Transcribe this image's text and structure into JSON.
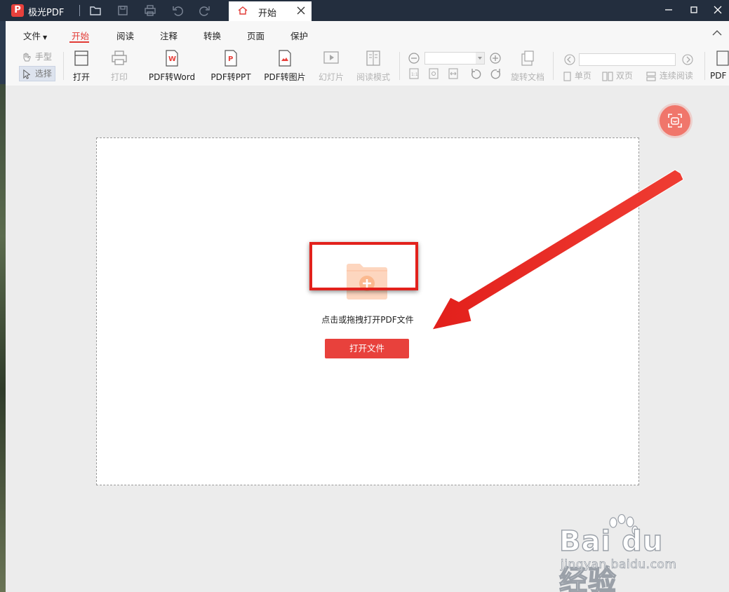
{
  "app": {
    "name": "极光PDF"
  },
  "tab": {
    "label": "开始"
  },
  "menu": [
    "文件",
    "开始",
    "阅读",
    "注释",
    "转换",
    "页面",
    "保护"
  ],
  "tools": {
    "hand": "手型",
    "select": "选择",
    "open": "打开",
    "print": "打印",
    "to_word": "PDF转Word",
    "to_ppt": "PDF转PPT",
    "to_image": "PDF转图片",
    "slideshow": "幻灯片",
    "reading_mode": "阅读模式",
    "rotate_doc": "旋转文档",
    "single_page": "单页",
    "double_page": "双页",
    "continuous": "连续阅读",
    "pdf_partial": "PDF"
  },
  "workspace": {
    "drop_hint": "点击或拖拽打开PDF文件",
    "open_button": "打开文件"
  },
  "watermark": {
    "main": "Bai du 经验",
    "sub": "jingyan.baidu.com"
  },
  "colors": {
    "accent": "#e8413c",
    "titlebar": "#232e3e",
    "highlight": "#e2211c",
    "fab": "#f0766b"
  }
}
